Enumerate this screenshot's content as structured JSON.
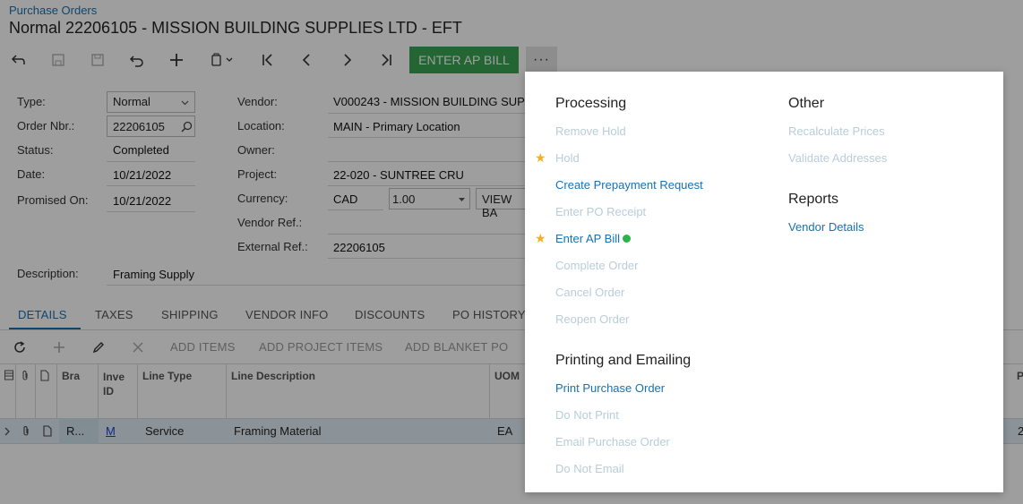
{
  "breadcrumb": "Purchase Orders",
  "title": "Normal 22206105 - MISSION BUILDING SUPPLIES LTD - EFT",
  "toolbar": {
    "primary_action": "ENTER AP BILL",
    "more": "···"
  },
  "form": {
    "type_label": "Type:",
    "type_value": "Normal",
    "order_label": "Order Nbr.:",
    "order_value": "22206105",
    "status_label": "Status:",
    "status_value": "Completed",
    "date_label": "Date:",
    "date_value": "10/21/2022",
    "promised_label": "Promised On:",
    "promised_value": "10/21/2022",
    "vendor_label": "Vendor:",
    "vendor_value": "V000243 - MISSION BUILDING SUP",
    "location_label": "Location:",
    "location_value": "MAIN - Primary Location",
    "owner_label": "Owner:",
    "project_label": "Project:",
    "project_value": "22-020 - SUNTREE CRU",
    "currency_label": "Currency:",
    "currency_value": "CAD",
    "rate_value": "1.00",
    "view_base": "VIEW BA",
    "vendor_ref_label": "Vendor Ref.:",
    "external_ref_label": "External Ref.:",
    "external_ref_value": "22206105",
    "description_label": "Description:",
    "description_value": "Framing Supply"
  },
  "tabs": [
    "DETAILS",
    "TAXES",
    "SHIPPING",
    "VENDOR INFO",
    "DISCOUNTS",
    "PO HISTORY"
  ],
  "grid_toolbar": [
    "ADD ITEMS",
    "ADD PROJECT ITEMS",
    "ADD BLANKET PO"
  ],
  "grid": {
    "headers": {
      "branch": "Bra",
      "inventory": "Inve ID",
      "line_type": "Line Type",
      "line_desc": "Line Description",
      "uom": "UOM",
      "last": "P"
    },
    "row": {
      "branch": "R...",
      "inventory": "M",
      "line_type": "Service",
      "line_desc": "Framing Material",
      "uom": "EA",
      "last": "2"
    }
  },
  "menu": {
    "processing": {
      "heading": "Processing",
      "items": [
        "Remove Hold",
        "Hold",
        "Create Prepayment Request",
        "Enter PO Receipt",
        "Enter AP Bill",
        "Complete Order",
        "Cancel Order",
        "Reopen Order"
      ]
    },
    "printing": {
      "heading": "Printing and Emailing",
      "items": [
        "Print Purchase Order",
        "Do Not Print",
        "Email Purchase Order",
        "Do Not Email"
      ]
    },
    "other": {
      "heading": "Other",
      "items": [
        "Recalculate Prices",
        "Validate Addresses"
      ]
    },
    "reports": {
      "heading": "Reports",
      "items": [
        "Vendor Details"
      ]
    }
  },
  "colors": {
    "accent": "#1672b5",
    "primary_button": "#3aa455",
    "star": "#f2b01e",
    "status_dot": "#2db34a",
    "disabled_text": "#b9cdd9"
  }
}
